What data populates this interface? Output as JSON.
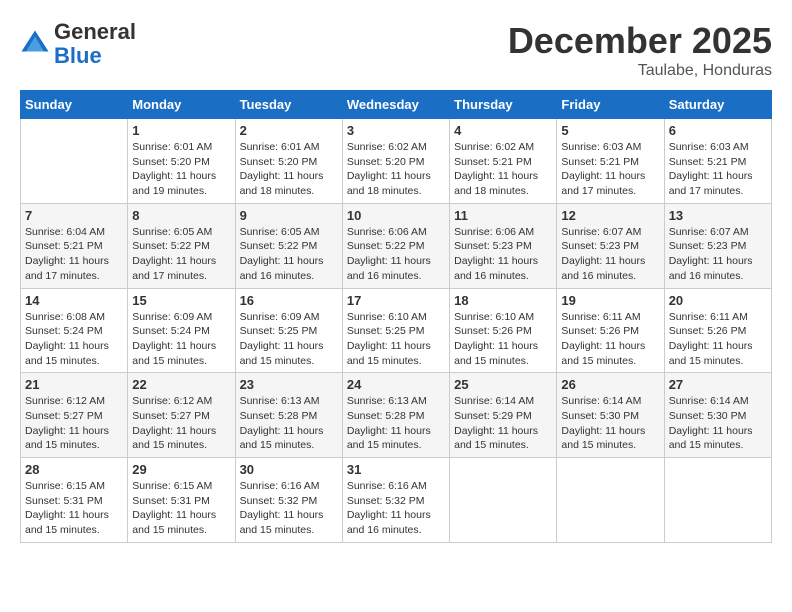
{
  "header": {
    "logo_line1": "General",
    "logo_line2": "Blue",
    "month": "December 2025",
    "location": "Taulabe, Honduras"
  },
  "days_of_week": [
    "Sunday",
    "Monday",
    "Tuesday",
    "Wednesday",
    "Thursday",
    "Friday",
    "Saturday"
  ],
  "weeks": [
    [
      {
        "day": "",
        "info": ""
      },
      {
        "day": "1",
        "info": "Sunrise: 6:01 AM\nSunset: 5:20 PM\nDaylight: 11 hours and 19 minutes."
      },
      {
        "day": "2",
        "info": "Sunrise: 6:01 AM\nSunset: 5:20 PM\nDaylight: 11 hours and 18 minutes."
      },
      {
        "day": "3",
        "info": "Sunrise: 6:02 AM\nSunset: 5:20 PM\nDaylight: 11 hours and 18 minutes."
      },
      {
        "day": "4",
        "info": "Sunrise: 6:02 AM\nSunset: 5:21 PM\nDaylight: 11 hours and 18 minutes."
      },
      {
        "day": "5",
        "info": "Sunrise: 6:03 AM\nSunset: 5:21 PM\nDaylight: 11 hours and 17 minutes."
      },
      {
        "day": "6",
        "info": "Sunrise: 6:03 AM\nSunset: 5:21 PM\nDaylight: 11 hours and 17 minutes."
      }
    ],
    [
      {
        "day": "7",
        "info": "Sunrise: 6:04 AM\nSunset: 5:21 PM\nDaylight: 11 hours and 17 minutes."
      },
      {
        "day": "8",
        "info": "Sunrise: 6:05 AM\nSunset: 5:22 PM\nDaylight: 11 hours and 17 minutes."
      },
      {
        "day": "9",
        "info": "Sunrise: 6:05 AM\nSunset: 5:22 PM\nDaylight: 11 hours and 16 minutes."
      },
      {
        "day": "10",
        "info": "Sunrise: 6:06 AM\nSunset: 5:22 PM\nDaylight: 11 hours and 16 minutes."
      },
      {
        "day": "11",
        "info": "Sunrise: 6:06 AM\nSunset: 5:23 PM\nDaylight: 11 hours and 16 minutes."
      },
      {
        "day": "12",
        "info": "Sunrise: 6:07 AM\nSunset: 5:23 PM\nDaylight: 11 hours and 16 minutes."
      },
      {
        "day": "13",
        "info": "Sunrise: 6:07 AM\nSunset: 5:23 PM\nDaylight: 11 hours and 16 minutes."
      }
    ],
    [
      {
        "day": "14",
        "info": "Sunrise: 6:08 AM\nSunset: 5:24 PM\nDaylight: 11 hours and 15 minutes."
      },
      {
        "day": "15",
        "info": "Sunrise: 6:09 AM\nSunset: 5:24 PM\nDaylight: 11 hours and 15 minutes."
      },
      {
        "day": "16",
        "info": "Sunrise: 6:09 AM\nSunset: 5:25 PM\nDaylight: 11 hours and 15 minutes."
      },
      {
        "day": "17",
        "info": "Sunrise: 6:10 AM\nSunset: 5:25 PM\nDaylight: 11 hours and 15 minutes."
      },
      {
        "day": "18",
        "info": "Sunrise: 6:10 AM\nSunset: 5:26 PM\nDaylight: 11 hours and 15 minutes."
      },
      {
        "day": "19",
        "info": "Sunrise: 6:11 AM\nSunset: 5:26 PM\nDaylight: 11 hours and 15 minutes."
      },
      {
        "day": "20",
        "info": "Sunrise: 6:11 AM\nSunset: 5:26 PM\nDaylight: 11 hours and 15 minutes."
      }
    ],
    [
      {
        "day": "21",
        "info": "Sunrise: 6:12 AM\nSunset: 5:27 PM\nDaylight: 11 hours and 15 minutes."
      },
      {
        "day": "22",
        "info": "Sunrise: 6:12 AM\nSunset: 5:27 PM\nDaylight: 11 hours and 15 minutes."
      },
      {
        "day": "23",
        "info": "Sunrise: 6:13 AM\nSunset: 5:28 PM\nDaylight: 11 hours and 15 minutes."
      },
      {
        "day": "24",
        "info": "Sunrise: 6:13 AM\nSunset: 5:28 PM\nDaylight: 11 hours and 15 minutes."
      },
      {
        "day": "25",
        "info": "Sunrise: 6:14 AM\nSunset: 5:29 PM\nDaylight: 11 hours and 15 minutes."
      },
      {
        "day": "26",
        "info": "Sunrise: 6:14 AM\nSunset: 5:30 PM\nDaylight: 11 hours and 15 minutes."
      },
      {
        "day": "27",
        "info": "Sunrise: 6:14 AM\nSunset: 5:30 PM\nDaylight: 11 hours and 15 minutes."
      }
    ],
    [
      {
        "day": "28",
        "info": "Sunrise: 6:15 AM\nSunset: 5:31 PM\nDaylight: 11 hours and 15 minutes."
      },
      {
        "day": "29",
        "info": "Sunrise: 6:15 AM\nSunset: 5:31 PM\nDaylight: 11 hours and 15 minutes."
      },
      {
        "day": "30",
        "info": "Sunrise: 6:16 AM\nSunset: 5:32 PM\nDaylight: 11 hours and 15 minutes."
      },
      {
        "day": "31",
        "info": "Sunrise: 6:16 AM\nSunset: 5:32 PM\nDaylight: 11 hours and 16 minutes."
      },
      {
        "day": "",
        "info": ""
      },
      {
        "day": "",
        "info": ""
      },
      {
        "day": "",
        "info": ""
      }
    ]
  ]
}
